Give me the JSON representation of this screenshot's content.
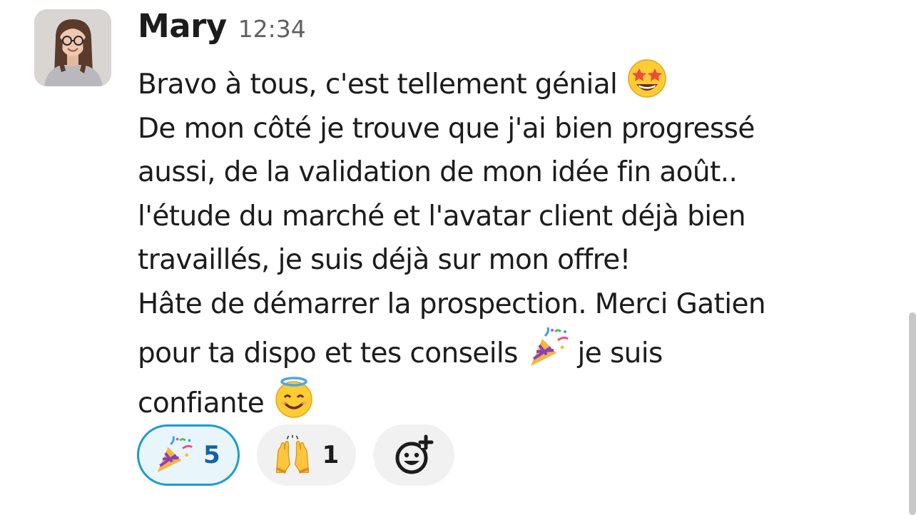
{
  "message": {
    "author": "Mary",
    "timestamp": "12:34",
    "lines": [
      "Bravo à tous, c'est tellement génial",
      "De mon côté je trouve que j'ai bien progressé",
      "aussi, de la validation de mon idée fin août..",
      "l'étude du marché et l'avatar client déjà bien",
      "travaillés, je suis déjà sur mon offre!",
      "Hâte de démarrer la prospection. Merci Gatien",
      "pour ta dispo et tes conseils",
      "je suis",
      "confiante"
    ],
    "inline_emojis": [
      "star-struck-emoji",
      "party-popper-emoji",
      "smiling-face-with-halo-emoji"
    ]
  },
  "reactions": [
    {
      "emoji": "party-popper-emoji",
      "count": "5",
      "selected": true
    },
    {
      "emoji": "raising-hands-emoji",
      "count": "1",
      "selected": false
    }
  ],
  "add_reaction": {
    "icon": "add-reaction-icon"
  },
  "colors": {
    "text": "#1d1c1d",
    "timestamp": "#616061",
    "reaction_bg": "#f1f1f1",
    "reaction_selected_bg": "#e8f5fa",
    "reaction_selected_border": "#1d9bd1",
    "reaction_selected_count": "#1264a3"
  }
}
